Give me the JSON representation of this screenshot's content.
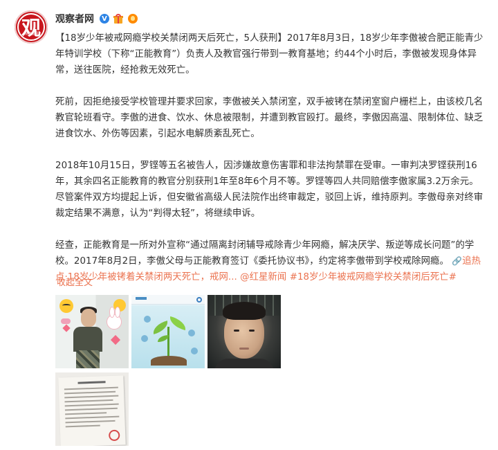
{
  "post": {
    "username": "观察者网",
    "verified_badge": "V",
    "avatar_char": "观",
    "avatar_sub": "观察者网",
    "paragraphs": [
      "【18岁少年被戒网瘾学校关禁闭两天后死亡，5人获刑】2017年8月3日，18岁少年李傲被合肥正能青少年特训学校（下称“正能教育”）负责人及教官强行带到一教育基地；约44个小时后，李傲被发现身体异常，送往医院，经抢救无效死亡。",
      "死前，因拒绝接受学校管理并要求回家，李傲被关入禁闭室，双手被铐在禁闭室窗户栅栏上，由该校几名教官轮班看守。李傲的进食、饮水、休息被限制，并遭到教官殴打。最终，李傲因高温、限制体位、缺乏进食饮水、外伤等因素，引起水电解质紊乱死亡。",
      "2018年10月15日，罗铿等五名被告人，因涉嫌故意伤害罪和非法拘禁罪在受审。一审判决罗铿获刑16年，其余四名正能教育的教官分别获刑1年至8年6个月不等。罗铿等四人共同赔偿李傲家属3.2万余元。尽管案件双方均提起上诉，但安徽省高级人民法院作出终审裁定，驳回上诉，维持原判。李傲母亲对终审裁定结果不满意，认为“判得太轻”，将继续申诉。"
    ],
    "last_paragraph": {
      "text": "经查，正能教育是一所对外宣称“通过隔离封闭辅导戒除青少年网瘾，解决厌学、叛逆等成长问题”的学校。2017年8月2日，李傲父母与正能教育签订《委托协议书》，约定将李傲带到学校戒除网瘾。",
      "link_icon": "paperclip-icon",
      "link_text": "追热点·18岁少年被铐着关禁闭两天死亡，戒网...",
      "mention": "@红星新闻",
      "hashtag": "#18岁少年被戒网瘾学校关禁闭后死亡#"
    },
    "collapse_label": "收起全文",
    "collapse_icon": "chevron-up-icon"
  },
  "images": [
    {
      "name": "photo-boy-with-stickers"
    },
    {
      "name": "screenshot-plant"
    },
    {
      "name": "photo-selfie"
    },
    {
      "name": "photo-document"
    }
  ],
  "colors": {
    "link": "#eb7350",
    "text": "#333333",
    "avatar": "#c8161d",
    "verified": "#2d84e5"
  }
}
